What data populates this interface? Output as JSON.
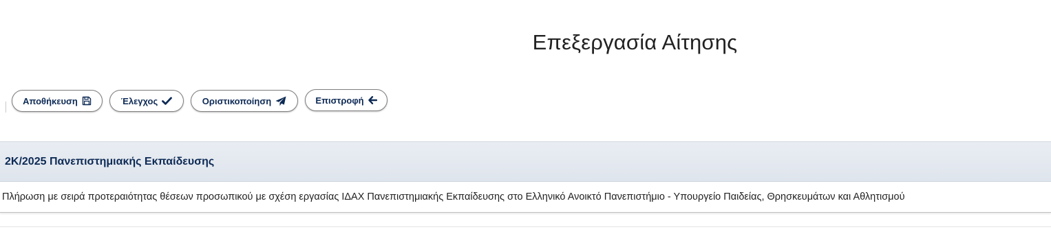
{
  "page": {
    "title": "Επεξεργασία Αίτησης"
  },
  "toolbar": {
    "save_label": "Αποθήκευση",
    "save_icon": "floppy-disk-icon",
    "check_label": "Έλεγχος",
    "check_icon": "checkmark-icon",
    "finalize_label": "Οριστικοποίηση",
    "finalize_icon": "paper-plane-icon",
    "back_label": "Επιστροφή",
    "back_icon": "arrow-left-icon"
  },
  "panel": {
    "title": "2Κ/2025 Πανεπιστημιακής Εκπαίδευσης",
    "description": "Πλήρωση με σειρά προτεραιότητας θέσεων προσωπικού με σχέση εργασίας ΙΔΑΧ Πανεπιστημιακής Εκπαίδευσης στο Ελληνικό Ανοικτό Πανεπιστήμιο - Υπουργείο Παιδείας, Θρησκευμάτων και Αθλητισμού"
  },
  "colors": {
    "accent_text": "#0d2a55",
    "panel_header_bg": "#e3e8ef",
    "button_border": "#7f7f7f"
  }
}
